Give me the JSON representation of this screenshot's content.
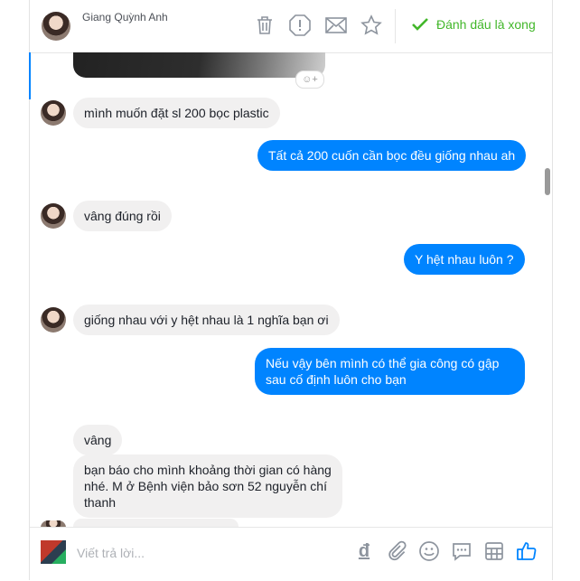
{
  "header": {
    "contact_name": "Giang Quỳnh Anh",
    "done_label": "Đánh dấu là xong",
    "icons": [
      "trash-icon",
      "alert-icon",
      "mail-icon",
      "star-icon",
      "check-icon"
    ]
  },
  "messages": [
    {
      "from": "them",
      "text": "mình muốn đặt sl 200 bọc plastic"
    },
    {
      "from": "me",
      "text": "Tất cả 200 cuốn cần bọc đều giống nhau ah"
    },
    {
      "from": "them",
      "text": "vâng đúng rồi"
    },
    {
      "from": "me",
      "text": "Y hệt nhau luôn ?"
    },
    {
      "from": "them",
      "text": "giống nhau với y hệt nhau là 1 nghĩa bạn ơi"
    },
    {
      "from": "me",
      "text": "Nếu vậy bên mình có thể gia công có gập sau cố định luôn cho bạn"
    },
    {
      "from": "them",
      "text": "vâng"
    },
    {
      "from": "them",
      "text": "bạn báo cho mình khoảng thời gian có hàng nhé. M ở Bệnh viện bảo sơn 52 nguyễn chí thanh"
    }
  ],
  "composer": {
    "placeholder": "Viết trả lời...",
    "currency_symbol": "đ",
    "icons": [
      "currency-icon",
      "attach-icon",
      "emoji-icon",
      "sticker-icon",
      "gif-icon",
      "like-icon"
    ]
  },
  "colors": {
    "accent": "#0084ff",
    "done": "#42b72a",
    "incoming": "#f1f0f0"
  }
}
